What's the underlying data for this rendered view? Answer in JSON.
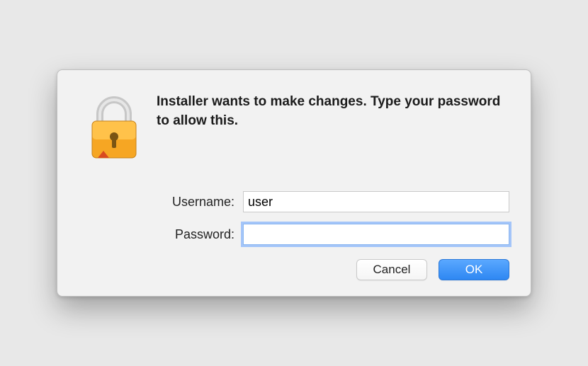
{
  "dialog": {
    "message": "Installer wants to make changes. Type your password to allow this.",
    "fields": {
      "username": {
        "label": "Username:",
        "value": "user"
      },
      "password": {
        "label": "Password:",
        "value": ""
      }
    },
    "buttons": {
      "cancel": "Cancel",
      "ok": "OK"
    },
    "icon": "lock-icon"
  }
}
